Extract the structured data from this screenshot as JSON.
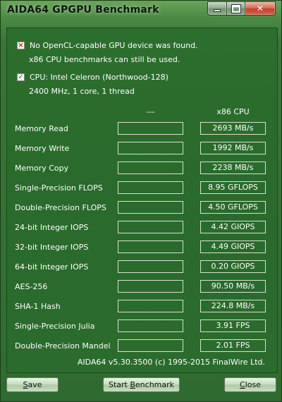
{
  "window": {
    "title": "AIDA64 GPGPU Benchmark",
    "close_glyph": "✕"
  },
  "messages": [
    {
      "icon": "error-icon",
      "line1": "No OpenCL-capable GPU device was found.",
      "line2": "x86 CPU benchmarks can still be used."
    },
    {
      "icon": "check-icon",
      "line1": "CPU: Intel Celeron (Northwood-128)",
      "line2": "2400 MHz, 1 core, 1 thread"
    }
  ],
  "table": {
    "headers": {
      "gpu": "---",
      "cpu": "x86 CPU"
    },
    "rows": [
      {
        "label": "Memory Read",
        "gpu": "",
        "cpu": "2693 MB/s"
      },
      {
        "label": "Memory Write",
        "gpu": "",
        "cpu": "1992 MB/s"
      },
      {
        "label": "Memory Copy",
        "gpu": "",
        "cpu": "2238 MB/s"
      },
      {
        "label": "Single-Precision FLOPS",
        "gpu": "",
        "cpu": "8.95 GFLOPS"
      },
      {
        "label": "Double-Precision FLOPS",
        "gpu": "",
        "cpu": "4.50 GFLOPS"
      },
      {
        "label": "24-bit Integer IOPS",
        "gpu": "",
        "cpu": "4.42 GIOPS"
      },
      {
        "label": "32-bit Integer IOPS",
        "gpu": "",
        "cpu": "4.49 GIOPS"
      },
      {
        "label": "64-bit Integer IOPS",
        "gpu": "",
        "cpu": "0.20 GIOPS"
      },
      {
        "label": "AES-256",
        "gpu": "",
        "cpu": "90.50 MB/s"
      },
      {
        "label": "SHA-1 Hash",
        "gpu": "",
        "cpu": "224.8 MB/s"
      },
      {
        "label": "Single-Precision Julia",
        "gpu": "",
        "cpu": "3.91 FPS"
      },
      {
        "label": "Double-Precision Mandel",
        "gpu": "",
        "cpu": "2.01 FPS"
      }
    ]
  },
  "footer": {
    "text": "AIDA64 v5.30.3500  (c) 1995-2015 FinalWire Ltd."
  },
  "buttons": {
    "save": {
      "mnemonic": "S",
      "rest": "ave"
    },
    "start": {
      "before": "Start ",
      "mnemonic": "B",
      "rest": "enchmark"
    },
    "close": {
      "mnemonic": "C",
      "rest": "lose"
    }
  }
}
